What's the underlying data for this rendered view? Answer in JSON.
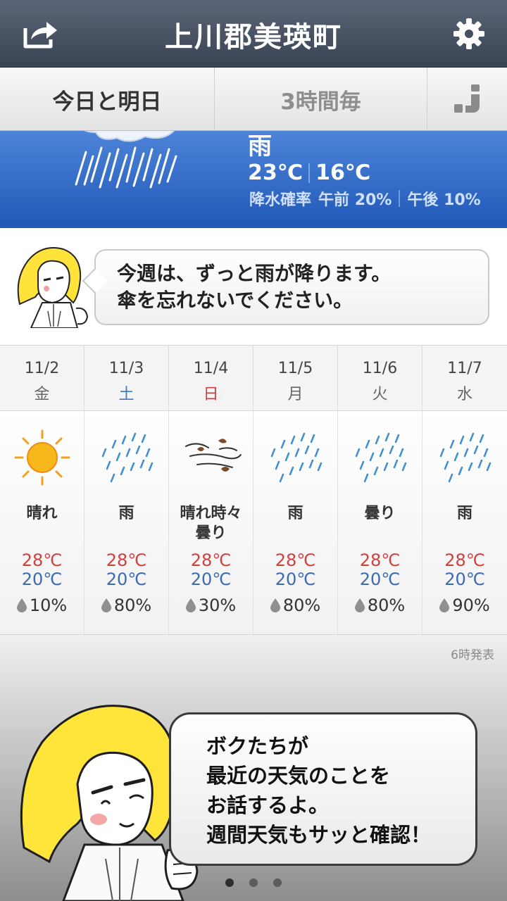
{
  "header": {
    "title": "上川郡美瑛町",
    "share_icon": "share-icon",
    "settings_icon": "gear-icon"
  },
  "tabs": [
    {
      "label": "今日と明日",
      "active": true
    },
    {
      "label": "3時間毎",
      "active": false
    },
    {
      "label": "",
      "icon": "layout-icon"
    }
  ],
  "today": {
    "weather": "雨",
    "high": "23℃",
    "low": "16℃",
    "precip_label": "降水確率",
    "am_label": "午前",
    "am_value": "20%",
    "pm_label": "午後",
    "pm_value": "10%",
    "icon": "rain-icon"
  },
  "message": {
    "line1": "今週は、ずっと雨が降ります。",
    "line2": "傘を忘れないでください。"
  },
  "week": [
    {
      "date": "11/2",
      "day": "金",
      "day_type": "weekday",
      "icon": "sun-icon",
      "cond1": "晴れ",
      "cond2": "",
      "high": "28℃",
      "low": "20℃",
      "precip": "10%"
    },
    {
      "date": "11/3",
      "day": "土",
      "day_type": "saturday",
      "icon": "rain-icon",
      "cond1": "雨",
      "cond2": "",
      "high": "28℃",
      "low": "20℃",
      "precip": "80%"
    },
    {
      "date": "11/4",
      "day": "日",
      "day_type": "sunday",
      "icon": "wind-icon",
      "cond1": "晴れ時々",
      "cond2": "曇り",
      "high": "28℃",
      "low": "20℃",
      "precip": "30%"
    },
    {
      "date": "11/5",
      "day": "月",
      "day_type": "weekday",
      "icon": "rain-icon",
      "cond1": "雨",
      "cond2": "",
      "high": "28℃",
      "low": "20℃",
      "precip": "80%"
    },
    {
      "date": "11/6",
      "day": "火",
      "day_type": "weekday",
      "icon": "rain-icon",
      "cond1": "曇り",
      "cond2": "",
      "high": "28℃",
      "low": "20℃",
      "precip": "80%"
    },
    {
      "date": "11/7",
      "day": "水",
      "day_type": "weekday",
      "icon": "rain-icon",
      "cond1": "雨",
      "cond2": "",
      "high": "28℃",
      "low": "20℃",
      "precip": "90%"
    }
  ],
  "announce": "6時発表",
  "promo": {
    "line1": "ボクたちが",
    "line2": "最近の天気のことを",
    "line3": "お話するよ。",
    "line4": "週間天気もサッと確認！"
  },
  "pager": {
    "count": 3,
    "active": 0
  },
  "colors": {
    "accent_blue": "#2f68c6",
    "high_temp": "#d0413e",
    "low_temp": "#3c6ab6",
    "header": "#474f5e"
  }
}
